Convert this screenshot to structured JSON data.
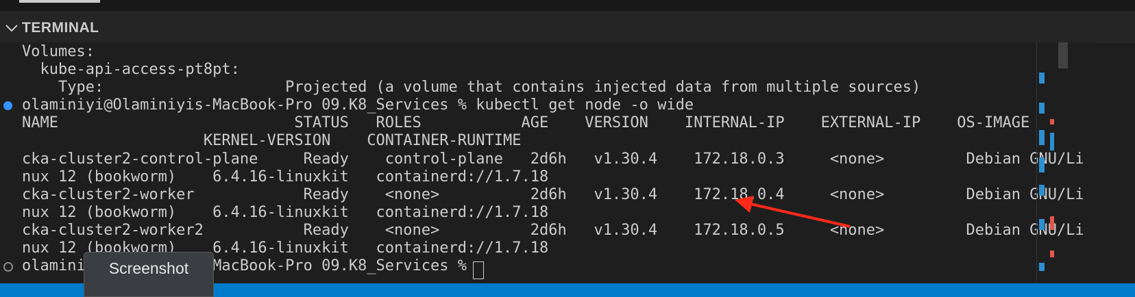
{
  "panel": {
    "title": "TERMINAL"
  },
  "terminal": {
    "lines": [
      "Volumes:",
      "  kube-api-access-pt8pt:",
      "    Type:                    Projected (a volume that contains injected data from multiple sources)",
      "olaminiyi@Olaminiyis-MacBook-Pro 09.K8_Services % kubectl get node -o wide",
      "NAME                          STATUS   ROLES           AGE    VERSION    INTERNAL-IP    EXTERNAL-IP    OS-IMAGE",
      "                    KERNEL-VERSION    CONTAINER-RUNTIME",
      "cka-cluster2-control-plane     Ready    control-plane   2d6h   v1.30.4    172.18.0.3     <none>         Debian GNU/Li",
      "nux 12 (bookworm)    6.4.16-linuxkit   containerd://1.7.18",
      "cka-cluster2-worker            Ready    <none>          2d6h   v1.30.4    172.18.0.4     <none>         Debian GNU/Li",
      "nux 12 (bookworm)    6.4.16-linuxkit   containerd://1.7.18",
      "cka-cluster2-worker2           Ready    <none>          2d6h   v1.30.4    172.18.0.5     <none>         Debian GNU/Li",
      "nux 12 (bookworm)    6.4.16-linuxkit   containerd://1.7.18",
      "olaminiyi@Olaminiyis-MacBook-Pro 09.K8_Services % "
    ]
  },
  "tooltip": {
    "label": "Screenshot"
  },
  "colors": {
    "accent": "#3794ff",
    "status_bar": "#007acc",
    "annotation_arrow": "#ff2a1a",
    "minimap_red": "#e2574c",
    "minimap_blue": "#2c8fd0"
  }
}
